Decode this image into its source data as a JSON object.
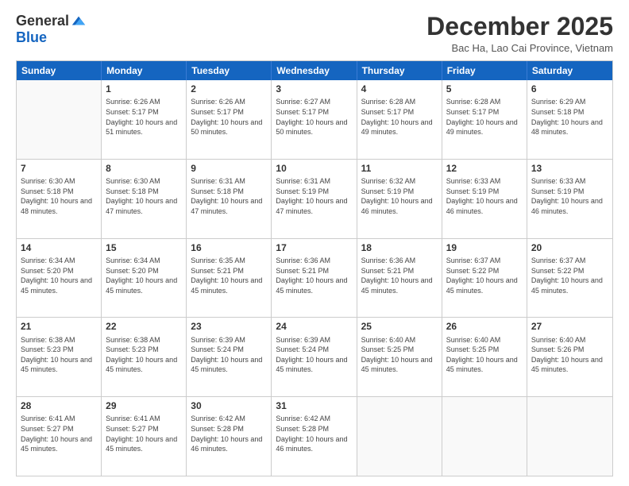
{
  "logo": {
    "general": "General",
    "blue": "Blue"
  },
  "title": "December 2025",
  "location": "Bac Ha, Lao Cai Province, Vietnam",
  "days_header": [
    "Sunday",
    "Monday",
    "Tuesday",
    "Wednesday",
    "Thursday",
    "Friday",
    "Saturday"
  ],
  "weeks": [
    [
      {
        "day": "",
        "sunrise": "",
        "sunset": "",
        "daylight": ""
      },
      {
        "day": "1",
        "sunrise": "Sunrise: 6:26 AM",
        "sunset": "Sunset: 5:17 PM",
        "daylight": "Daylight: 10 hours and 51 minutes."
      },
      {
        "day": "2",
        "sunrise": "Sunrise: 6:26 AM",
        "sunset": "Sunset: 5:17 PM",
        "daylight": "Daylight: 10 hours and 50 minutes."
      },
      {
        "day": "3",
        "sunrise": "Sunrise: 6:27 AM",
        "sunset": "Sunset: 5:17 PM",
        "daylight": "Daylight: 10 hours and 50 minutes."
      },
      {
        "day": "4",
        "sunrise": "Sunrise: 6:28 AM",
        "sunset": "Sunset: 5:17 PM",
        "daylight": "Daylight: 10 hours and 49 minutes."
      },
      {
        "day": "5",
        "sunrise": "Sunrise: 6:28 AM",
        "sunset": "Sunset: 5:17 PM",
        "daylight": "Daylight: 10 hours and 49 minutes."
      },
      {
        "day": "6",
        "sunrise": "Sunrise: 6:29 AM",
        "sunset": "Sunset: 5:18 PM",
        "daylight": "Daylight: 10 hours and 48 minutes."
      }
    ],
    [
      {
        "day": "7",
        "sunrise": "Sunrise: 6:30 AM",
        "sunset": "Sunset: 5:18 PM",
        "daylight": "Daylight: 10 hours and 48 minutes."
      },
      {
        "day": "8",
        "sunrise": "Sunrise: 6:30 AM",
        "sunset": "Sunset: 5:18 PM",
        "daylight": "Daylight: 10 hours and 47 minutes."
      },
      {
        "day": "9",
        "sunrise": "Sunrise: 6:31 AM",
        "sunset": "Sunset: 5:18 PM",
        "daylight": "Daylight: 10 hours and 47 minutes."
      },
      {
        "day": "10",
        "sunrise": "Sunrise: 6:31 AM",
        "sunset": "Sunset: 5:19 PM",
        "daylight": "Daylight: 10 hours and 47 minutes."
      },
      {
        "day": "11",
        "sunrise": "Sunrise: 6:32 AM",
        "sunset": "Sunset: 5:19 PM",
        "daylight": "Daylight: 10 hours and 46 minutes."
      },
      {
        "day": "12",
        "sunrise": "Sunrise: 6:33 AM",
        "sunset": "Sunset: 5:19 PM",
        "daylight": "Daylight: 10 hours and 46 minutes."
      },
      {
        "day": "13",
        "sunrise": "Sunrise: 6:33 AM",
        "sunset": "Sunset: 5:19 PM",
        "daylight": "Daylight: 10 hours and 46 minutes."
      }
    ],
    [
      {
        "day": "14",
        "sunrise": "Sunrise: 6:34 AM",
        "sunset": "Sunset: 5:20 PM",
        "daylight": "Daylight: 10 hours and 45 minutes."
      },
      {
        "day": "15",
        "sunrise": "Sunrise: 6:34 AM",
        "sunset": "Sunset: 5:20 PM",
        "daylight": "Daylight: 10 hours and 45 minutes."
      },
      {
        "day": "16",
        "sunrise": "Sunrise: 6:35 AM",
        "sunset": "Sunset: 5:21 PM",
        "daylight": "Daylight: 10 hours and 45 minutes."
      },
      {
        "day": "17",
        "sunrise": "Sunrise: 6:36 AM",
        "sunset": "Sunset: 5:21 PM",
        "daylight": "Daylight: 10 hours and 45 minutes."
      },
      {
        "day": "18",
        "sunrise": "Sunrise: 6:36 AM",
        "sunset": "Sunset: 5:21 PM",
        "daylight": "Daylight: 10 hours and 45 minutes."
      },
      {
        "day": "19",
        "sunrise": "Sunrise: 6:37 AM",
        "sunset": "Sunset: 5:22 PM",
        "daylight": "Daylight: 10 hours and 45 minutes."
      },
      {
        "day": "20",
        "sunrise": "Sunrise: 6:37 AM",
        "sunset": "Sunset: 5:22 PM",
        "daylight": "Daylight: 10 hours and 45 minutes."
      }
    ],
    [
      {
        "day": "21",
        "sunrise": "Sunrise: 6:38 AM",
        "sunset": "Sunset: 5:23 PM",
        "daylight": "Daylight: 10 hours and 45 minutes."
      },
      {
        "day": "22",
        "sunrise": "Sunrise: 6:38 AM",
        "sunset": "Sunset: 5:23 PM",
        "daylight": "Daylight: 10 hours and 45 minutes."
      },
      {
        "day": "23",
        "sunrise": "Sunrise: 6:39 AM",
        "sunset": "Sunset: 5:24 PM",
        "daylight": "Daylight: 10 hours and 45 minutes."
      },
      {
        "day": "24",
        "sunrise": "Sunrise: 6:39 AM",
        "sunset": "Sunset: 5:24 PM",
        "daylight": "Daylight: 10 hours and 45 minutes."
      },
      {
        "day": "25",
        "sunrise": "Sunrise: 6:40 AM",
        "sunset": "Sunset: 5:25 PM",
        "daylight": "Daylight: 10 hours and 45 minutes."
      },
      {
        "day": "26",
        "sunrise": "Sunrise: 6:40 AM",
        "sunset": "Sunset: 5:25 PM",
        "daylight": "Daylight: 10 hours and 45 minutes."
      },
      {
        "day": "27",
        "sunrise": "Sunrise: 6:40 AM",
        "sunset": "Sunset: 5:26 PM",
        "daylight": "Daylight: 10 hours and 45 minutes."
      }
    ],
    [
      {
        "day": "28",
        "sunrise": "Sunrise: 6:41 AM",
        "sunset": "Sunset: 5:27 PM",
        "daylight": "Daylight: 10 hours and 45 minutes."
      },
      {
        "day": "29",
        "sunrise": "Sunrise: 6:41 AM",
        "sunset": "Sunset: 5:27 PM",
        "daylight": "Daylight: 10 hours and 45 minutes."
      },
      {
        "day": "30",
        "sunrise": "Sunrise: 6:42 AM",
        "sunset": "Sunset: 5:28 PM",
        "daylight": "Daylight: 10 hours and 46 minutes."
      },
      {
        "day": "31",
        "sunrise": "Sunrise: 6:42 AM",
        "sunset": "Sunset: 5:28 PM",
        "daylight": "Daylight: 10 hours and 46 minutes."
      },
      {
        "day": "",
        "sunrise": "",
        "sunset": "",
        "daylight": ""
      },
      {
        "day": "",
        "sunrise": "",
        "sunset": "",
        "daylight": ""
      },
      {
        "day": "",
        "sunrise": "",
        "sunset": "",
        "daylight": ""
      }
    ]
  ]
}
